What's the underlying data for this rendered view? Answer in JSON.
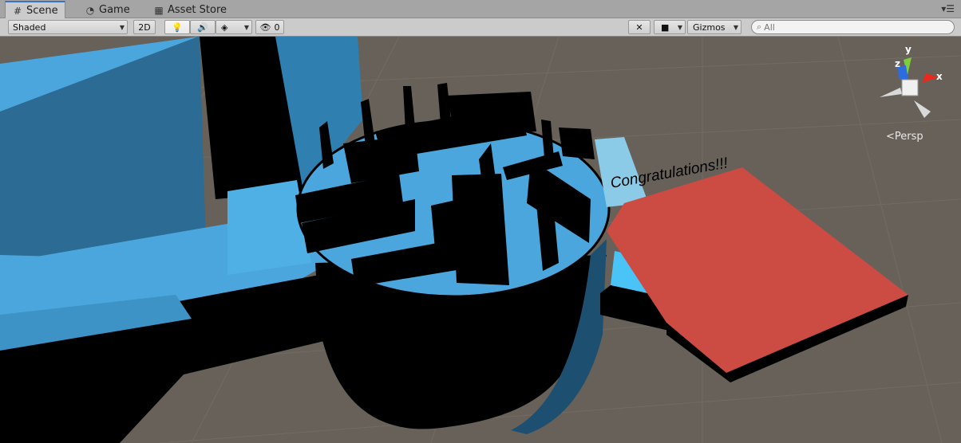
{
  "tabs": [
    {
      "label": "Scene",
      "icon": "grid-icon",
      "active": true
    },
    {
      "label": "Game",
      "icon": "pacman-icon",
      "active": false
    },
    {
      "label": "Asset Store",
      "icon": "store-icon",
      "active": false
    }
  ],
  "toolbar": {
    "shading_mode": "Shaded",
    "mode_2d": "2D",
    "hidden_count": "0",
    "gizmos_label": "Gizmos",
    "search_placeholder": "All"
  },
  "scene": {
    "congrats_text": "Congratulations!!!",
    "projection_label": "Persp",
    "axis_x": "x",
    "axis_y": "y",
    "axis_z": "z"
  },
  "colors": {
    "ground": "#676159",
    "blue": "#4ba6dc",
    "red": "#d04a40",
    "black": "#000000"
  }
}
